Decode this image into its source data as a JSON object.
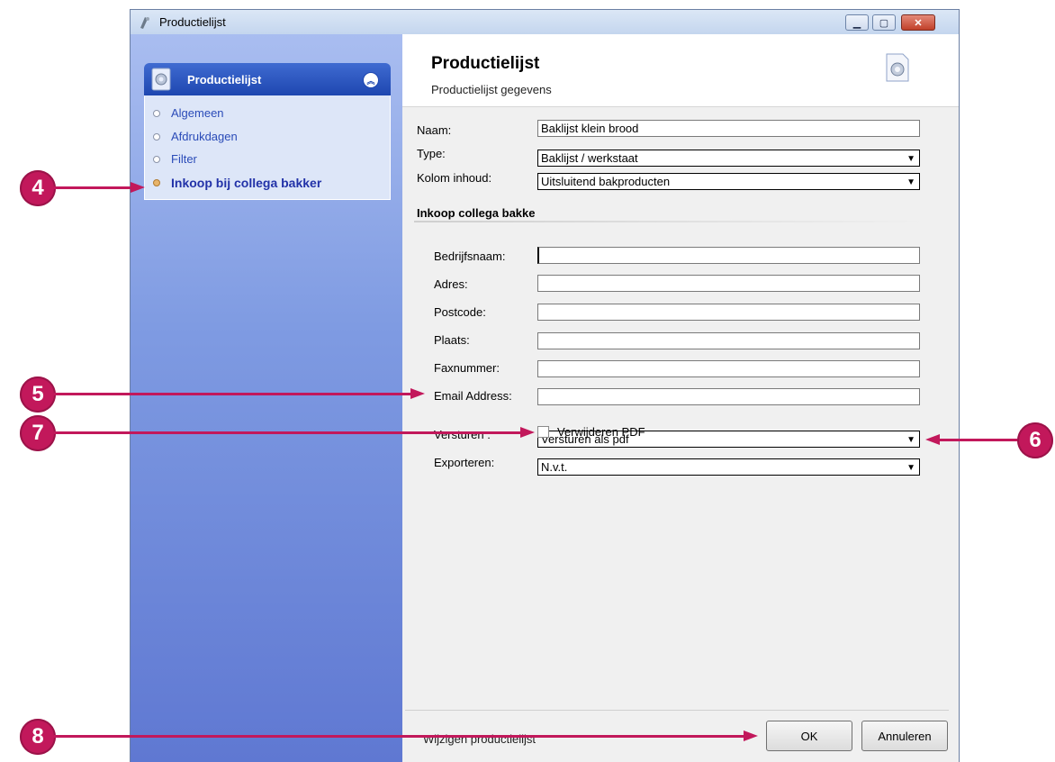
{
  "window": {
    "title": "Productielijst"
  },
  "sidebar": {
    "group_title": "Productielijst",
    "items": [
      {
        "label": "Algemeen"
      },
      {
        "label": "Afdrukdagen"
      },
      {
        "label": "Filter"
      },
      {
        "label": "Inkoop bij collega bakker",
        "active": true
      }
    ]
  },
  "header": {
    "title": "Productielijst",
    "subtitle": "Productielijst gegevens"
  },
  "form": {
    "naam": {
      "label": "Naam:",
      "value": "Baklijst klein brood"
    },
    "type": {
      "label": "Type:",
      "value": "Baklijst / werkstaat"
    },
    "kolom": {
      "label": "Kolom inhoud:",
      "value": "Uitsluitend bakproducten"
    },
    "section_title": "Inkoop collega bakke",
    "bedrijfsnaam": {
      "label": "Bedrijfsnaam:",
      "value": ""
    },
    "adres": {
      "label": "Adres:",
      "value": ""
    },
    "postcode": {
      "label": "Postcode:",
      "value": ""
    },
    "plaats": {
      "label": "Plaats:",
      "value": ""
    },
    "faxnummer": {
      "label": "Faxnummer:",
      "value": ""
    },
    "email": {
      "label": "Email Address:",
      "value": ""
    },
    "versturen": {
      "label": "Versturen :",
      "value": "Versturen als pdf"
    },
    "exporteren": {
      "label": "Exporteren:",
      "value": "N.v.t."
    },
    "verwijderen_pdf": {
      "label": "Verwijderen PDF",
      "checked": false
    }
  },
  "footer": {
    "status": "Wijzigen productielijst",
    "ok_label": "OK",
    "cancel_label": "Annuleren"
  },
  "callouts": [
    "4",
    "5",
    "6",
    "7",
    "8"
  ],
  "colors": {
    "callout": "#c2185b",
    "sidebar_header": "#1e47b0"
  }
}
